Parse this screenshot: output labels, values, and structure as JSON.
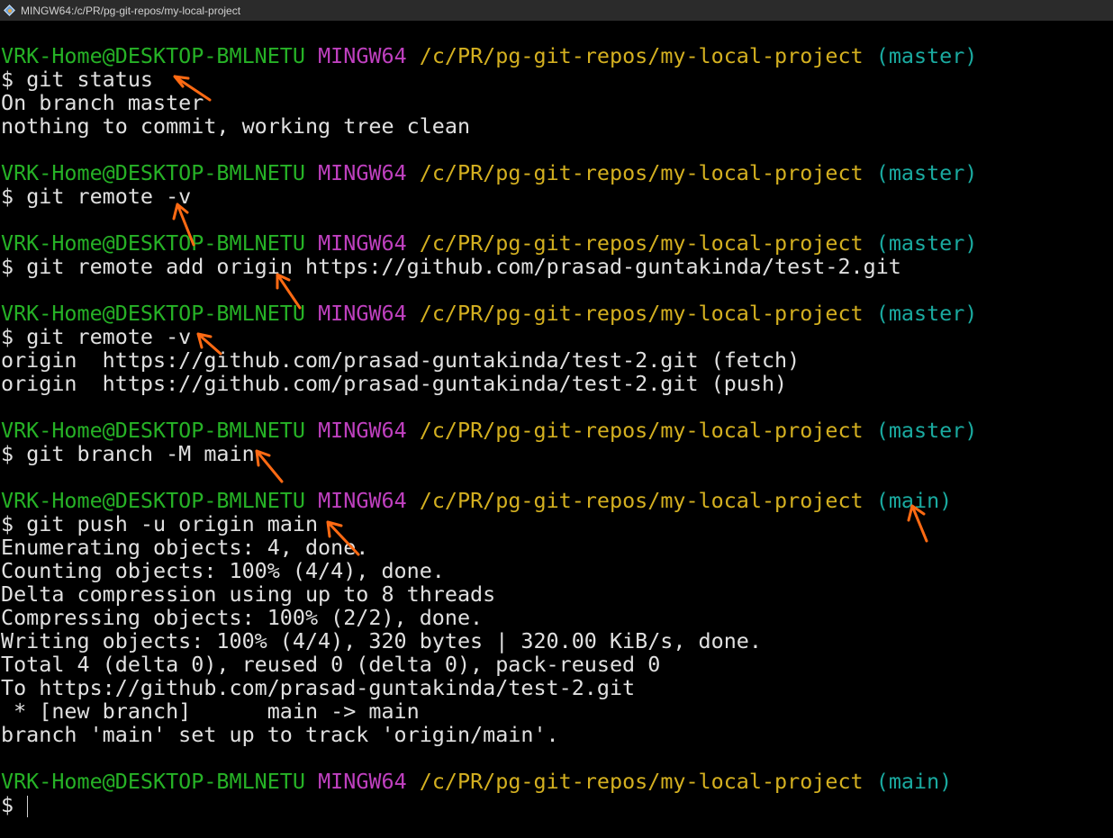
{
  "window": {
    "title": "MINGW64:/c/PR/pg-git-repos/my-local-project",
    "icon": "git-bash-icon"
  },
  "colors": {
    "background": "#000000",
    "user_host": "#26b226",
    "mingw": "#bf40bf",
    "path": "#d4b020",
    "branch": "#1aaaa0",
    "output": "#e0e0e0",
    "annotation_arrow": "#ff6a13"
  },
  "prompt": {
    "user_host": "VRK-Home@DESKTOP-BMLNETU",
    "system": "MINGW64",
    "path": "/c/PR/pg-git-repos/my-local-project",
    "symbol": "$"
  },
  "blocks": [
    {
      "branch": "(master)",
      "command": "git status",
      "output": [
        "On branch master",
        "nothing to commit, working tree clean"
      ]
    },
    {
      "branch": "(master)",
      "command": "git remote -v",
      "output": []
    },
    {
      "branch": "(master)",
      "command": "git remote add origin https://github.com/prasad-guntakinda/test-2.git",
      "output": []
    },
    {
      "branch": "(master)",
      "command": "git remote -v",
      "output": [
        "origin  https://github.com/prasad-guntakinda/test-2.git (fetch)",
        "origin  https://github.com/prasad-guntakinda/test-2.git (push)"
      ]
    },
    {
      "branch": "(master)",
      "command": "git branch -M main",
      "output": []
    },
    {
      "branch": "(main)",
      "command": "git push -u origin main",
      "output": [
        "Enumerating objects: 4, done.",
        "Counting objects: 100% (4/4), done.",
        "Delta compression using up to 8 threads",
        "Compressing objects: 100% (2/2), done.",
        "Writing objects: 100% (4/4), 320 bytes | 320.00 KiB/s, done.",
        "Total 4 (delta 0), reused 0 (delta 0), pack-reused 0",
        "To https://github.com/prasad-guntakinda/test-2.git",
        " * [new branch]      main -> main",
        "branch 'main' set up to track 'origin/main'."
      ]
    },
    {
      "branch": "(main)",
      "command": "",
      "output": []
    }
  ]
}
